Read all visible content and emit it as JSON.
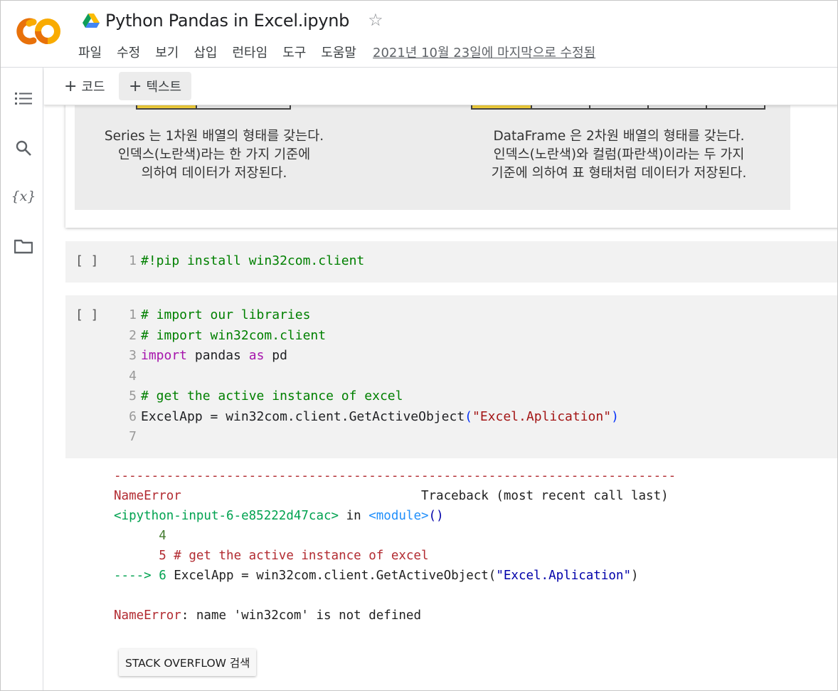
{
  "header": {
    "title": "Python Pandas in Excel.ipynb",
    "menu": [
      "파일",
      "수정",
      "보기",
      "삽입",
      "런타임",
      "도구",
      "도움말"
    ],
    "last_edited": "2021년 10월 23일에 마지막으로 수정됨"
  },
  "sidebar": {
    "icons": [
      "toc-icon",
      "search-icon",
      "variables-icon",
      "folder-icon"
    ],
    "variables_glyph": "{x}"
  },
  "toolbar": {
    "add_code_label": "코드",
    "add_text_label": "텍스트",
    "plus": "+"
  },
  "text_cell": {
    "caption_left": [
      "Series 는 1차원 배열의 형태를 갖는다.",
      "인덱스(노란색)라는 한 가지 기준에",
      "의하여 데이터가 저장된다."
    ],
    "caption_right": [
      "DataFrame 은 2차원 배열의 형태를 갖는다.",
      "인덱스(노란색)와 컬럼(파란색)이라는 두 가지",
      "기준에 의하여 표 형태처럼 데이터가 저장된다."
    ]
  },
  "cell1": {
    "bracket": "[ ]",
    "lines": [
      {
        "num": "1",
        "text": "#!pip install win32com.client"
      }
    ]
  },
  "cell2": {
    "bracket": "[ ]",
    "line_numbers": [
      "1",
      "2",
      "3",
      "4",
      "5",
      "6",
      "7"
    ],
    "line1": "# import our libraries",
    "line2": "# import win32com.client",
    "line3_kw1": "import",
    "line3_mid": " pandas ",
    "line3_kw2": "as",
    "line3_end": " pd",
    "line5": "# get the active instance of excel",
    "line6_pre": "ExcelApp = win32com.client.GetActiveObject",
    "line6_open": "(",
    "line6_str": "\"Excel.Aplication\"",
    "line6_close": ")"
  },
  "output": {
    "dashes": "---------------------------------------------------------------------------",
    "error_name": "NameError",
    "traceback_label": "Traceback (most recent call last)",
    "input_ref": "<ipython-input-6-e85222d47cac>",
    "in_word": " in ",
    "module_ref": "<module>",
    "module_parens": "()",
    "tb_line4": "      4",
    "tb_line5": "      5 # get the active instance of excel",
    "arrow": "----> 6 ",
    "tb_line6_pre": "ExcelApp = win32com.client.GetActiveObject(",
    "tb_line6_str": "\"Excel.Aplication\"",
    "tb_line6_close": ")",
    "final_error_name": "NameError",
    "final_error_msg": ": name 'win32com' is not defined"
  },
  "stack_overflow_button": "STACK OVERFLOW 검색",
  "colors": {
    "logo_orange": "#f9ab00",
    "logo_dark": "#e8710a",
    "comment": "#008000",
    "keyword": "#a614ac",
    "string": "#a31515",
    "error_red": "#b22b31"
  }
}
